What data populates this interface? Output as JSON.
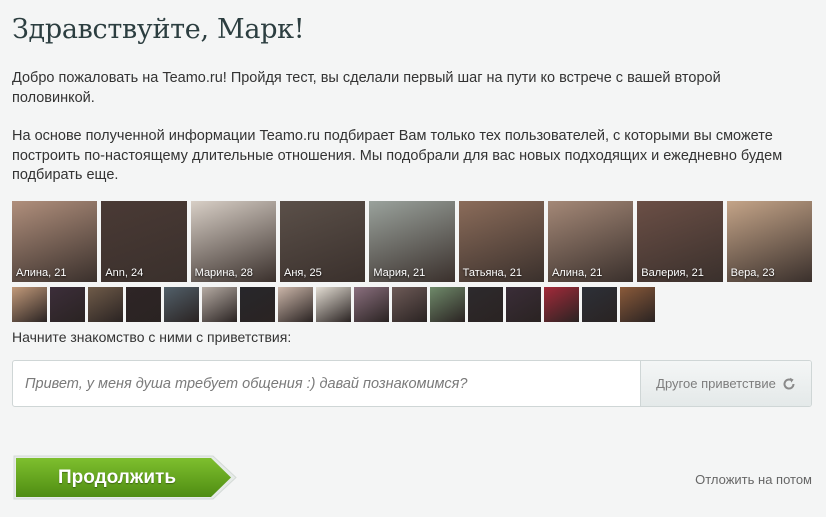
{
  "header": {
    "title": "Здравствуйте, Марк!"
  },
  "intro": {
    "paragraph1": "Добро пожаловать на Teamo.ru! Пройдя тест, вы сделали первый шаг на пути ко встрече с вашей второй половинкой.",
    "paragraph2": "На основе полученной информации Teamo.ru подбирает Вам только тех пользователей, с которыми вы сможете построить по-настоящему длительные отношения. Мы подобрали для вас новых подходящих и ежедневно будем подбирать еще."
  },
  "matches": [
    {
      "label": "Алина, 21",
      "color": "#b08f7c"
    },
    {
      "label": "Ann, 24",
      "color": "#4a3a35"
    },
    {
      "label": "Марина, 28",
      "color": "#d8cfc6"
    },
    {
      "label": "Аня, 25",
      "color": "#5b5049"
    },
    {
      "label": "Мария, 21",
      "color": "#9aa29c"
    },
    {
      "label": "Татьяна, 21",
      "color": "#8b6c5a"
    },
    {
      "label": "Алина, 21",
      "color": "#a48877"
    },
    {
      "label": "Валерия, 21",
      "color": "#6b4f46"
    },
    {
      "label": "Вера, 23",
      "color": "#c4a488"
    }
  ],
  "thumbnails": [
    {
      "color": "#c29a7a"
    },
    {
      "color": "#3c2e3a"
    },
    {
      "color": "#6f5b49"
    },
    {
      "color": "#2e2526"
    },
    {
      "color": "#52606a"
    },
    {
      "color": "#b5aba3"
    },
    {
      "color": "#27272b"
    },
    {
      "color": "#cbb6a9"
    },
    {
      "color": "#e3ddd3"
    },
    {
      "color": "#8a6f7e"
    },
    {
      "color": "#6d5a57"
    },
    {
      "color": "#6f8a6a"
    },
    {
      "color": "#2d2a2d"
    },
    {
      "color": "#3a2d38"
    },
    {
      "color": "#a32a3a"
    },
    {
      "color": "#2c3038"
    },
    {
      "color": "#8a5a3a"
    }
  ],
  "greeting": {
    "prompt": "Начните знакомство с ними с приветствия:",
    "placeholder": "Привет, у меня душа требует общения :) давай познакомимся?",
    "alt_label": "Другое приветствие",
    "alt_icon": "refresh-icon"
  },
  "actions": {
    "continue_label": "Продолжить",
    "later_label": "Отложить на потом"
  },
  "colors": {
    "continue_top": "#7ebf2e",
    "continue_bottom": "#4f8d12"
  }
}
